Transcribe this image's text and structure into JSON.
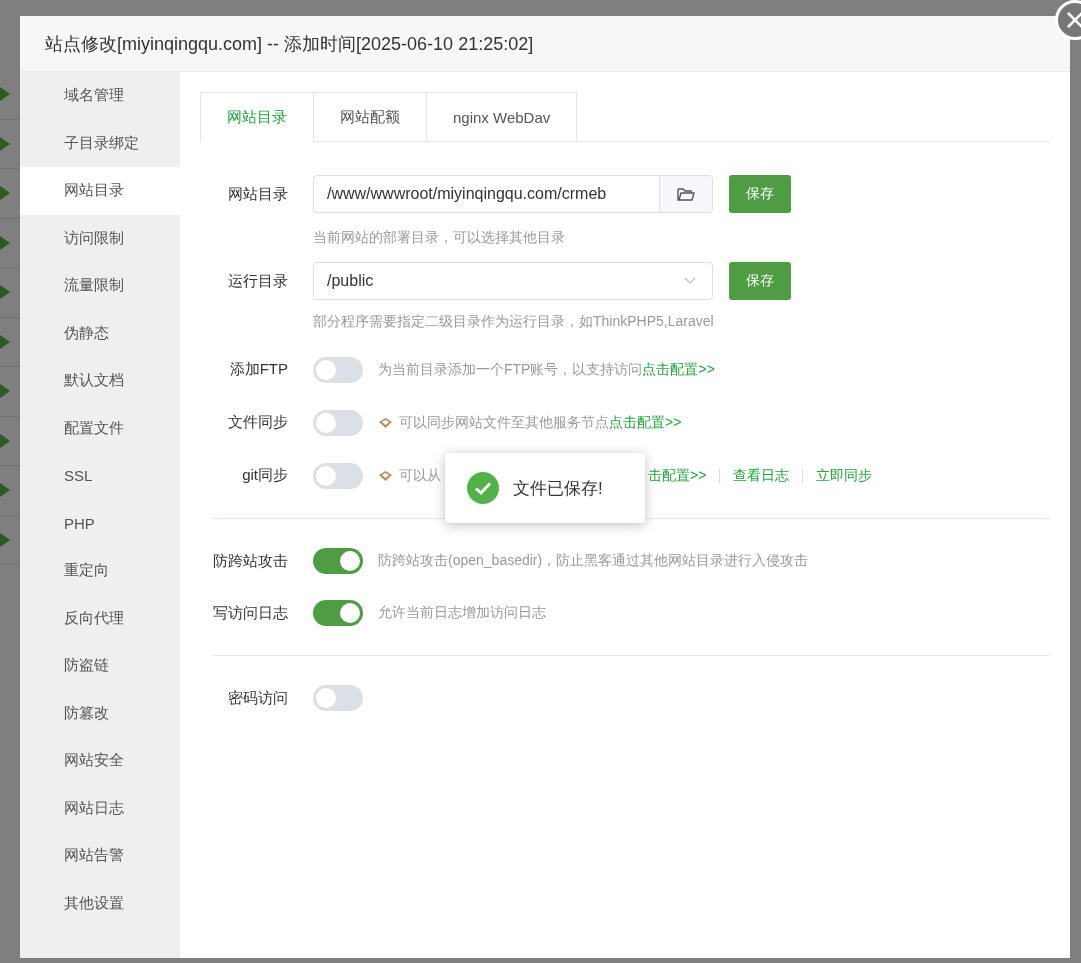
{
  "dialog": {
    "title": "站点修改[miyinqingqu.com] -- 添加时间[2025-06-10 21:25:02]"
  },
  "sidebar": {
    "items": [
      {
        "label": "域名管理",
        "selected": false
      },
      {
        "label": "子目录绑定",
        "selected": false
      },
      {
        "label": "网站目录",
        "selected": true
      },
      {
        "label": "访问限制",
        "selected": false
      },
      {
        "label": "流量限制",
        "selected": false
      },
      {
        "label": "伪静态",
        "selected": false
      },
      {
        "label": "默认文档",
        "selected": false
      },
      {
        "label": "配置文件",
        "selected": false
      },
      {
        "label": "SSL",
        "selected": false
      },
      {
        "label": "PHP",
        "selected": false
      },
      {
        "label": "重定向",
        "selected": false
      },
      {
        "label": "反向代理",
        "selected": false
      },
      {
        "label": "防盗链",
        "selected": false
      },
      {
        "label": "防篡改",
        "selected": false
      },
      {
        "label": "网站安全",
        "selected": false
      },
      {
        "label": "网站日志",
        "selected": false
      },
      {
        "label": "网站告警",
        "selected": false
      },
      {
        "label": "其他设置",
        "selected": false
      }
    ]
  },
  "tabs": [
    {
      "label": "网站目录",
      "selected": true
    },
    {
      "label": "网站配额",
      "selected": false
    },
    {
      "label": "nginx WebDav",
      "selected": false
    }
  ],
  "rows": [
    {
      "kind": "path",
      "label": "网站目录",
      "value": "/www/wwwroot/miyinqingqu.com/crmeb",
      "button": "保存",
      "hint": "当前网站的部署目录，可以选择其他目录"
    },
    {
      "kind": "select",
      "label": "运行目录",
      "value": "/public",
      "button": "保存",
      "hint": "部分程序需要指定二级目录作为运行目录，如ThinkPHP5,Laravel"
    },
    {
      "kind": "toggle",
      "label": "添加FTP",
      "on": false,
      "description": "为当前目录添加一个FTP账号，以支持访问",
      "links": [
        "点击配置>>"
      ]
    },
    {
      "kind": "toggle",
      "label": "文件同步",
      "on": false,
      "premium": true,
      "description": "可以同步网站文件至其他服务节点",
      "links": [
        "点击配置>>"
      ]
    },
    {
      "kind": "toggle",
      "label": "git同步",
      "on": false,
      "premium": true,
      "description": "可以从",
      "covered": true,
      "links": [
        "击配置>>",
        "查看日志",
        "立即同步"
      ]
    },
    {
      "kind": "divider"
    },
    {
      "kind": "toggle",
      "label": "防跨站攻击",
      "on": true,
      "description": "防跨站攻击(open_basedir)，防止黑客通过其他网站目录进行入侵攻击",
      "links": []
    },
    {
      "kind": "toggle",
      "label": "写访问日志",
      "on": true,
      "description": "允许当前日志增加访问日志",
      "links": []
    },
    {
      "kind": "divider"
    },
    {
      "kind": "toggle",
      "label": "密码访问",
      "on": false,
      "links": []
    }
  ],
  "toast": {
    "message": "文件已保存!"
  }
}
